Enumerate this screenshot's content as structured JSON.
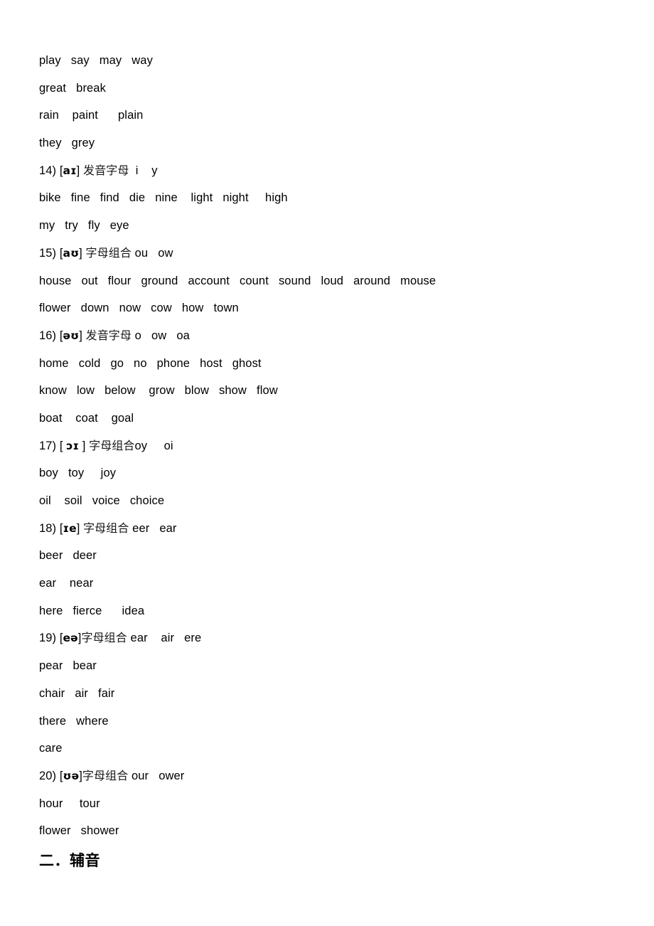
{
  "document": {
    "page_background": "#ffffff",
    "text_color": "#000000",
    "lines": [
      {
        "kind": "words",
        "text": "play   say   may   way"
      },
      {
        "kind": "words",
        "text": "great   break"
      },
      {
        "kind": "words",
        "text": "rain    paint      plain"
      },
      {
        "kind": "words",
        "text": "they   grey"
      },
      {
        "kind": "rule",
        "index": "14)",
        "ipa_open": "[",
        "ipa": "aɪ",
        "ipa_close": "]",
        "cn": "发音字母",
        "combo": "  i    y"
      },
      {
        "kind": "words",
        "text": "bike   fine   find   die   nine    light   night     high"
      },
      {
        "kind": "words",
        "text": "my   try   fly   eye"
      },
      {
        "kind": "rule",
        "index": "15)",
        "ipa_open": "[",
        "ipa": "aʊ",
        "ipa_close": "]",
        "cn": "字母组合",
        "combo": " ou   ow"
      },
      {
        "kind": "words",
        "text": "house   out   flour   ground   account   count   sound   loud   around   mouse"
      },
      {
        "kind": "words",
        "text": "flower   down   now   cow   how   town"
      },
      {
        "kind": "rule",
        "index": "16)",
        "ipa_open": "[",
        "ipa": "əʊ",
        "ipa_close": "]",
        "cn": "发音字母",
        "combo": " o   ow   oa"
      },
      {
        "kind": "words",
        "text": "home   cold   go   no   phone   host   ghost"
      },
      {
        "kind": "words",
        "text": "know   low   below    grow   blow   show   flow"
      },
      {
        "kind": "words",
        "text": "boat    coat    goal"
      },
      {
        "kind": "rule",
        "index": "17)",
        "ipa_open": "[ ",
        "ipa": "ɔɪ",
        "ipa_close": " ]",
        "cn": "字母组合",
        "combo": "oy     oi"
      },
      {
        "kind": "words",
        "text": "boy   toy     joy"
      },
      {
        "kind": "words",
        "text": "oil    soil   voice   choice"
      },
      {
        "kind": "rule",
        "index": "18)",
        "ipa_open": "[",
        "ipa": "ɪe",
        "ipa_close": "]",
        "cn": "字母组合",
        "combo": " eer   ear"
      },
      {
        "kind": "words",
        "text": "beer   deer"
      },
      {
        "kind": "words",
        "text": "ear    near"
      },
      {
        "kind": "words",
        "text": "here   fierce      idea"
      },
      {
        "kind": "rule",
        "index": "19)",
        "ipa_open": "[",
        "ipa": "eə",
        "ipa_close": "]",
        "cn": "字母组合",
        "combo": " ear    air   ere",
        "no_space_after_ipa": true
      },
      {
        "kind": "words",
        "text": "pear   bear"
      },
      {
        "kind": "words",
        "text": "chair   air   fair"
      },
      {
        "kind": "words",
        "text": "there   where"
      },
      {
        "kind": "words",
        "text": "care"
      },
      {
        "kind": "rule",
        "index": "20)",
        "ipa_open": "[",
        "ipa": "ʊə",
        "ipa_close": "]",
        "cn": "字母组合",
        "combo": " our   ower",
        "no_space_after_ipa": true
      },
      {
        "kind": "words",
        "text": "hour     tour"
      },
      {
        "kind": "words",
        "text": "flower   shower"
      },
      {
        "kind": "heading",
        "text": "二．辅音"
      }
    ]
  }
}
